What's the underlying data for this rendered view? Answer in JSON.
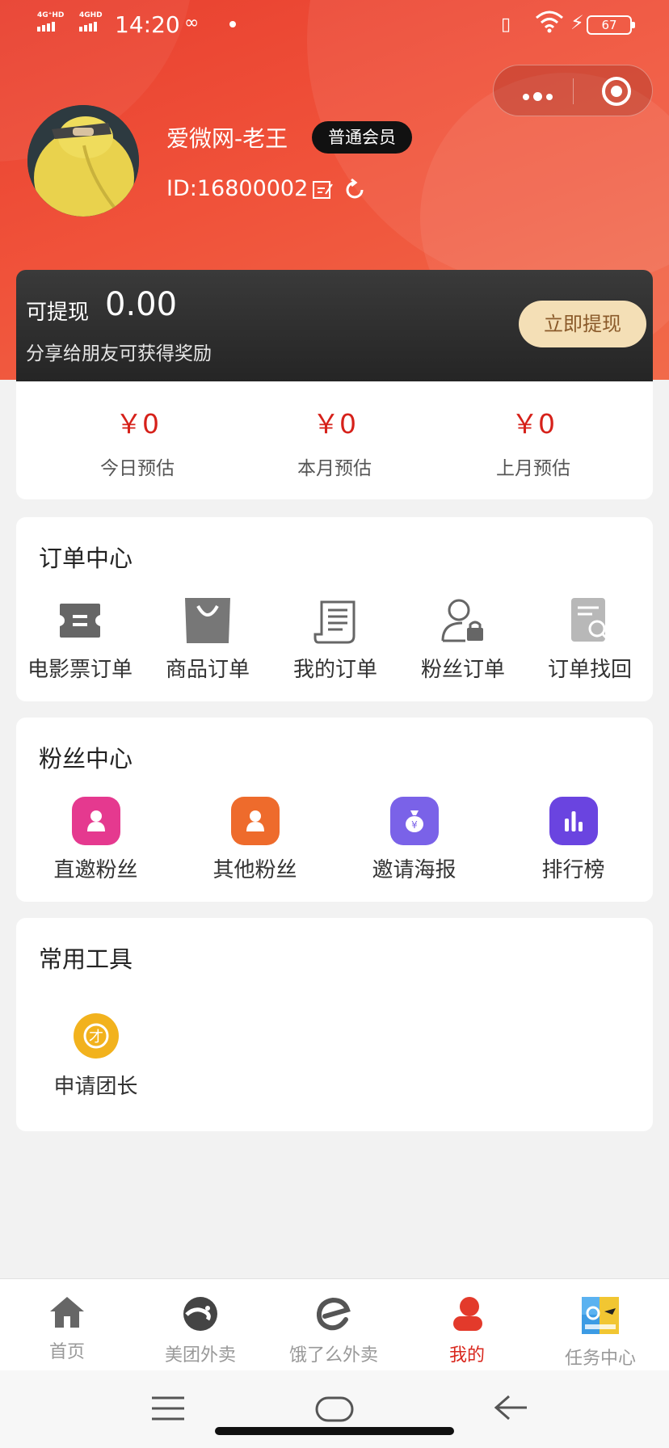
{
  "status_bar": {
    "sim1": "4G⁺HD",
    "sim2": "4GHD",
    "time": "14:20",
    "battery": "67"
  },
  "profile": {
    "nickname": "爱微网-老王",
    "member_level": "普通会员",
    "user_id": "ID:16800002"
  },
  "withdraw": {
    "label": "可提现",
    "amount": "0.00",
    "tip": "分享给朋友可获得奖励",
    "button": "立即提现"
  },
  "estimates": [
    {
      "value": "￥0",
      "label": "今日预估"
    },
    {
      "value": "￥0",
      "label": "本月预估"
    },
    {
      "value": "￥0",
      "label": "上月预估"
    }
  ],
  "order_center": {
    "title": "订单中心",
    "items": [
      {
        "label": "电影票订单",
        "icon": "ticket-icon"
      },
      {
        "label": "商品订单",
        "icon": "shopping-bag-icon"
      },
      {
        "label": "我的订单",
        "icon": "scroll-list-icon"
      },
      {
        "label": "粉丝订单",
        "icon": "user-lock-icon"
      },
      {
        "label": "订单找回",
        "icon": "document-search-icon"
      }
    ]
  },
  "fan_center": {
    "title": "粉丝中心",
    "items": [
      {
        "label": "直邀粉丝",
        "icon": "person-icon",
        "color": "#e5398f"
      },
      {
        "label": "其他粉丝",
        "icon": "person-icon",
        "color": "#ee6b2c"
      },
      {
        "label": "邀请海报",
        "icon": "money-bag-icon",
        "color": "#7a62e8"
      },
      {
        "label": "排行榜",
        "icon": "bar-chart-icon",
        "color": "#6a44e0"
      }
    ]
  },
  "tools": {
    "title": "常用工具",
    "items": [
      {
        "label": "申请团长",
        "icon": "team-leader-icon",
        "color": "#f2b21d"
      }
    ]
  },
  "tab_bar": [
    {
      "label": "首页",
      "icon": "home-icon"
    },
    {
      "label": "美团外卖",
      "icon": "meituan-icon"
    },
    {
      "label": "饿了么外卖",
      "icon": "eleme-icon"
    },
    {
      "label": "我的",
      "icon": "profile-icon",
      "active": true
    },
    {
      "label": "任务中心",
      "icon": "task-center-icon"
    }
  ],
  "colors": {
    "header_red": "#e8402f",
    "price_red": "#d6211a",
    "active_tab": "#d9261c",
    "withdraw_button": "#f4dfb6"
  }
}
